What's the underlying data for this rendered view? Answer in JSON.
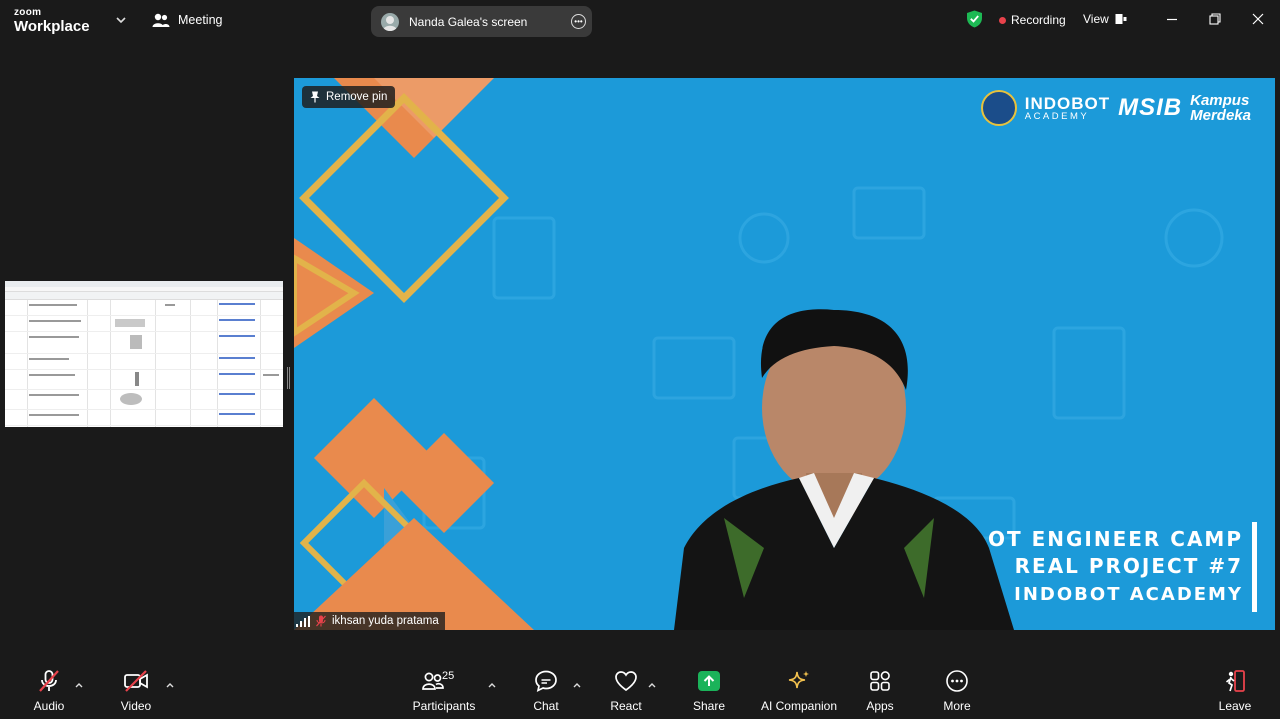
{
  "topbar": {
    "brand_small": "zoom",
    "brand_large": "Workplace",
    "meeting_label": "Meeting",
    "share_label": "Nanda Galea's screen",
    "recording_label": "Recording",
    "view_label": "View"
  },
  "video": {
    "remove_pin_label": "Remove pin",
    "participant_name": "ikhsan yuda pratama",
    "logo_indobot_top": "INDOBOT",
    "logo_indobot_bottom": "ACADEMY",
    "logo_msib": "MSIB",
    "logo_km_top": "Kampus",
    "logo_km_bottom": "Merdeka",
    "banner_line1": "OT ENGINEER CAMP",
    "banner_line2": "REAL PROJECT #7",
    "banner_line3": "INDOBOT ACADEMY"
  },
  "toolbar": {
    "audio": "Audio",
    "video": "Video",
    "participants": "Participants",
    "participants_count": "25",
    "chat": "Chat",
    "react": "React",
    "share": "Share",
    "ai_companion": "AI Companion",
    "apps": "Apps",
    "more": "More",
    "leave": "Leave"
  },
  "colors": {
    "shield_green": "#1db954",
    "recording_red": "#e8424b",
    "share_green": "#1bb35a",
    "ai_gold": "#f2c14e",
    "leave_red": "#e8424b",
    "muted_red": "#e8424b",
    "video_bg": "#1c9ad9",
    "accent_orange": "#e98a4d",
    "accent_gold": "#e2b34a"
  },
  "icons": {
    "meeting": "participants-icon",
    "shield": "shield-check-icon",
    "audio": "microphone-muted-icon",
    "video": "camera-off-icon",
    "participants": "participants-icon",
    "chat": "chat-bubble-icon",
    "react": "heart-icon",
    "share": "share-arrow-icon",
    "ai": "sparkle-icon",
    "apps": "apps-icon",
    "more": "more-dots-icon",
    "leave": "leave-door-icon"
  }
}
